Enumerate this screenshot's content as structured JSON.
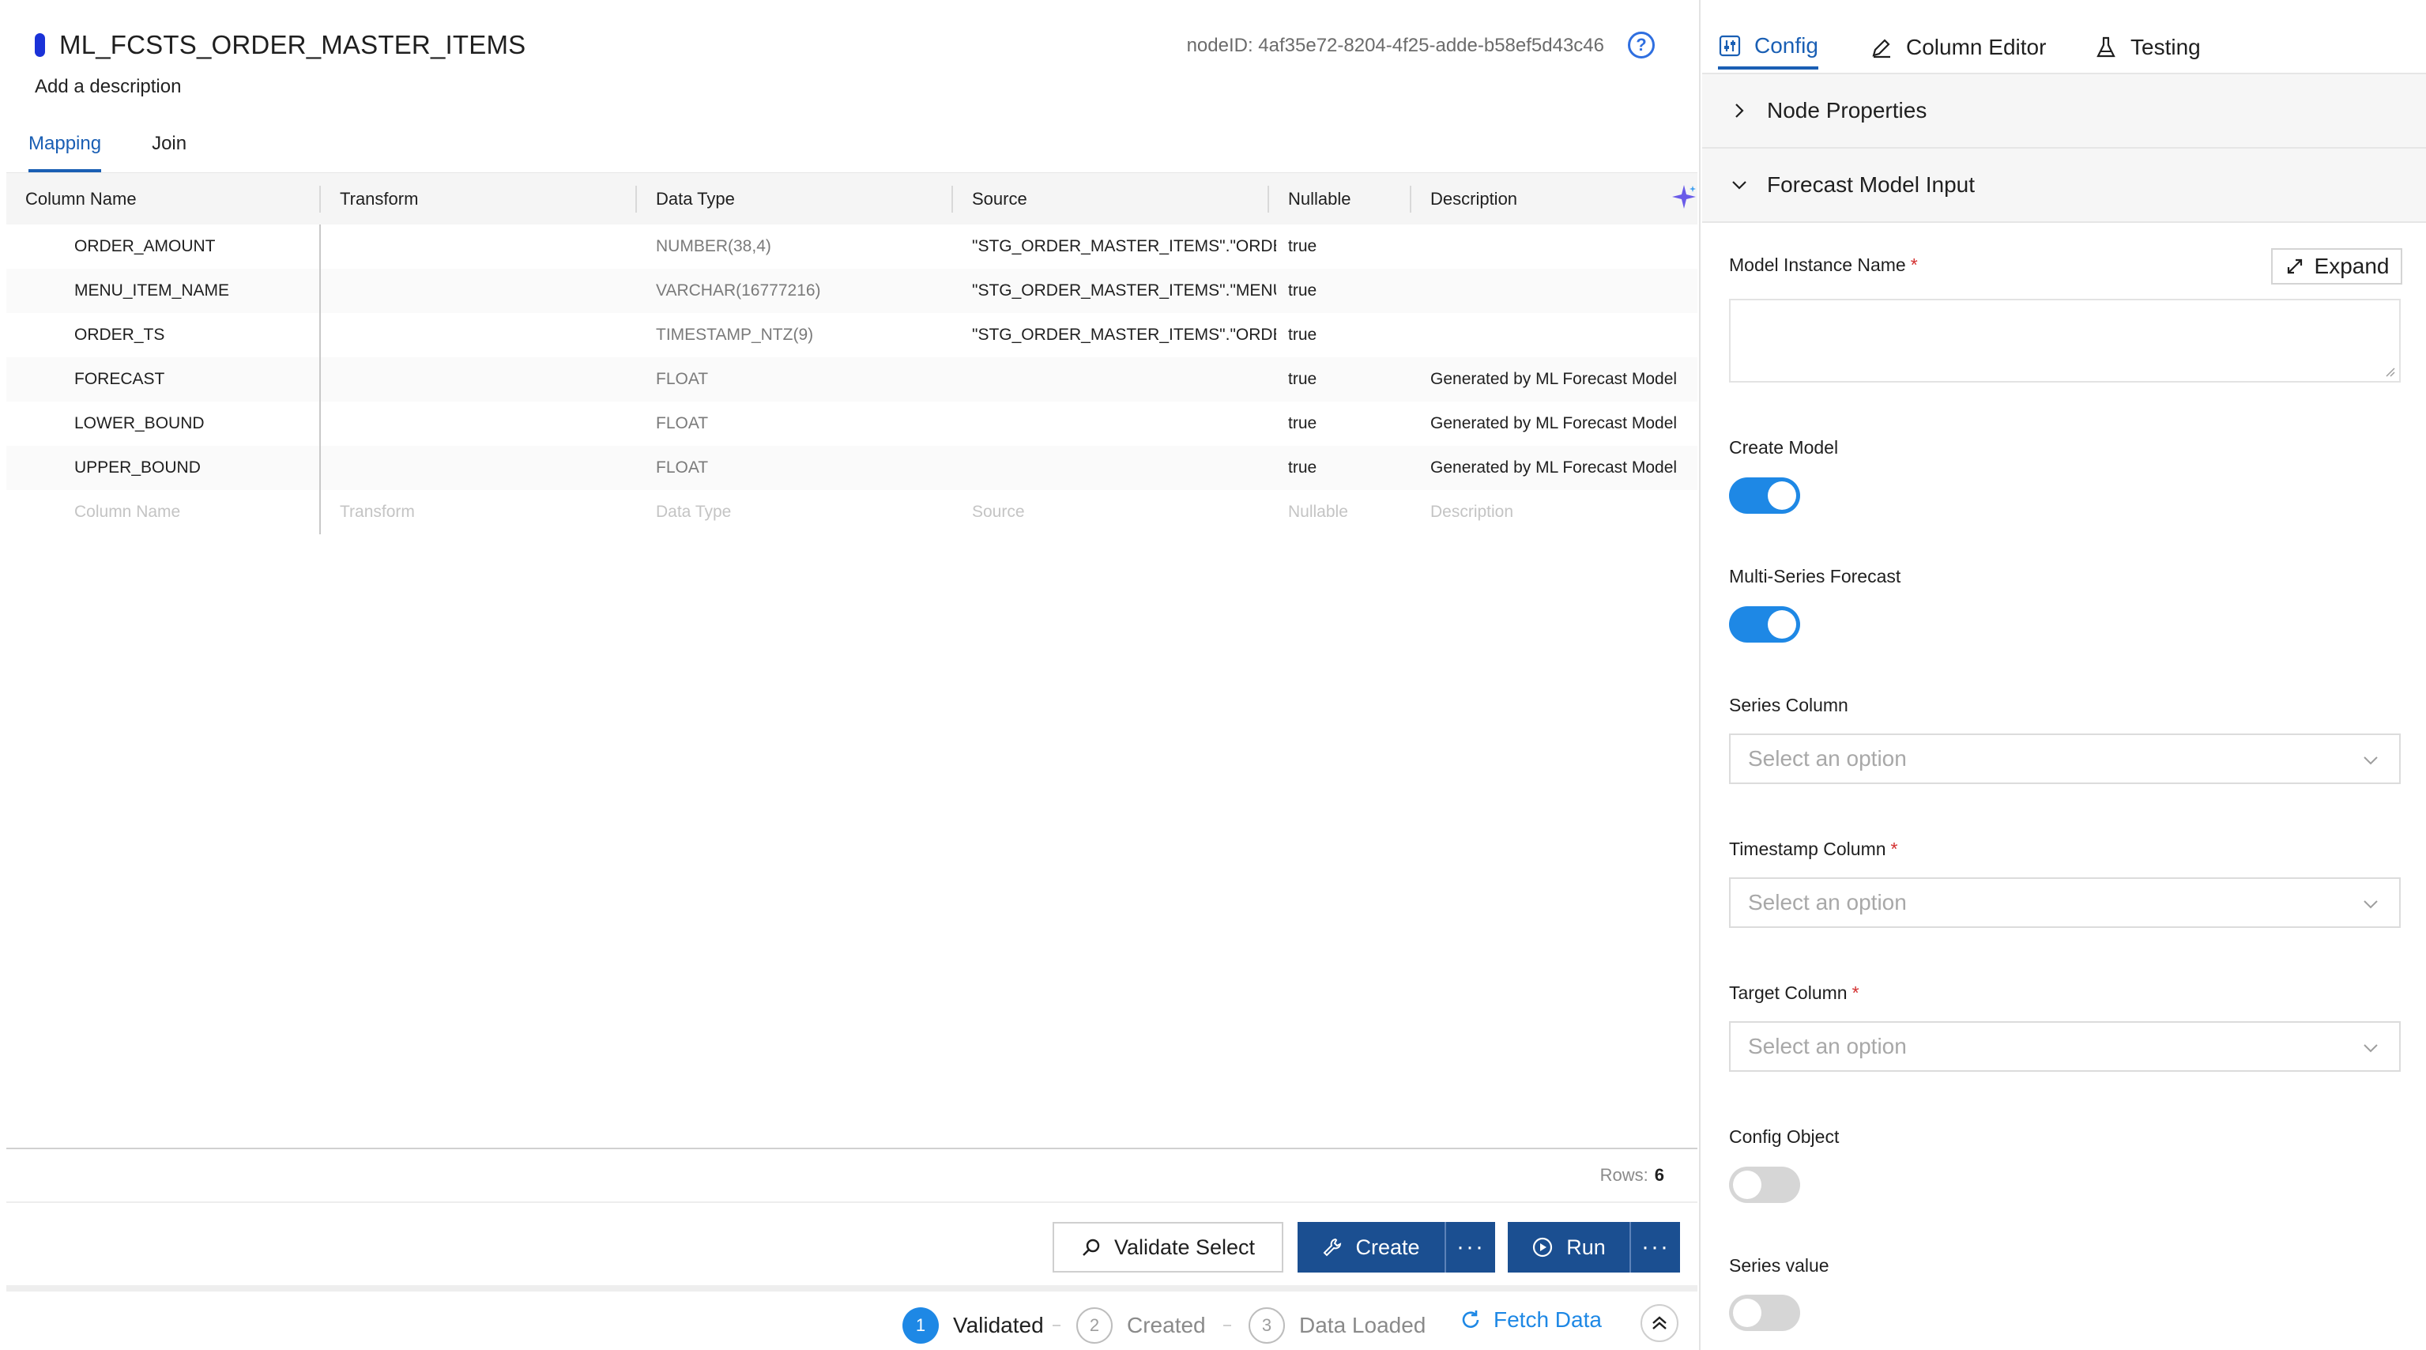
{
  "node": {
    "title": "ML_FCSTS_ORDER_MASTER_ITEMS",
    "description_placeholder": "Add a description",
    "node_id": "nodeID: 4af35e72-8204-4f25-adde-b58ef5d43c46"
  },
  "left_tabs": [
    {
      "label": "Mapping",
      "active": true
    },
    {
      "label": "Join",
      "active": false
    }
  ],
  "grid": {
    "headers": [
      "Column Name",
      "Transform",
      "Data Type",
      "Source",
      "Nullable",
      "Description"
    ],
    "rows": [
      {
        "name": "ORDER_AMOUNT",
        "transform": "",
        "data_type": "NUMBER(38,4)",
        "source": "\"STG_ORDER_MASTER_ITEMS\".\"ORDEI",
        "nullable": "true",
        "description": ""
      },
      {
        "name": "MENU_ITEM_NAME",
        "transform": "",
        "data_type": "VARCHAR(16777216)",
        "source": "\"STG_ORDER_MASTER_ITEMS\".\"MENU",
        "nullable": "true",
        "description": ""
      },
      {
        "name": "ORDER_TS",
        "transform": "",
        "data_type": "TIMESTAMP_NTZ(9)",
        "source": "\"STG_ORDER_MASTER_ITEMS\".\"ORDEI",
        "nullable": "true",
        "description": ""
      },
      {
        "name": "FORECAST",
        "transform": "",
        "data_type": "FLOAT",
        "source": "",
        "nullable": "true",
        "description": "Generated by ML Forecast Model"
      },
      {
        "name": "LOWER_BOUND",
        "transform": "",
        "data_type": "FLOAT",
        "source": "",
        "nullable": "true",
        "description": "Generated by ML Forecast Model"
      },
      {
        "name": "UPPER_BOUND",
        "transform": "",
        "data_type": "FLOAT",
        "source": "",
        "nullable": "true",
        "description": "Generated by ML Forecast Model"
      }
    ],
    "new_row_placeholders": {
      "name": "Column Name",
      "transform": "Transform",
      "data_type": "Data Type",
      "source": "Source",
      "nullable": "Nullable",
      "description": "Description"
    },
    "rows_label": "Rows:",
    "rows_count": "6"
  },
  "actions": {
    "validate_label": "Validate Select",
    "create_label": "Create",
    "run_label": "Run",
    "more_label": "···"
  },
  "status": {
    "steps": [
      {
        "num": "1",
        "label": "Validated",
        "state": "done"
      },
      {
        "num": "2",
        "label": "Created",
        "state": "todo"
      },
      {
        "num": "3",
        "label": "Data Loaded",
        "state": "todo"
      }
    ],
    "fetch_label": "Fetch Data"
  },
  "right_tabs": [
    {
      "label": "Config",
      "active": true
    },
    {
      "label": "Column Editor",
      "active": false
    },
    {
      "label": "Testing",
      "active": false
    }
  ],
  "sections": {
    "node_properties": "Node Properties",
    "forecast_model_input": "Forecast Model Input"
  },
  "form": {
    "model_instance_name_label": "Model Instance Name",
    "expand_label": "Expand",
    "create_model_label": "Create Model",
    "create_model_on": true,
    "multi_series_label": "Multi-Series Forecast",
    "multi_series_on": true,
    "series_column_label": "Series Column",
    "timestamp_column_label": "Timestamp Column",
    "target_column_label": "Target Column",
    "select_placeholder": "Select an option",
    "config_object_label": "Config Object",
    "config_object_on": false,
    "series_value_label": "Series value",
    "series_value_on": false,
    "required_mark": "*"
  },
  "colors": {
    "accent": "#1a5fb4",
    "primary_button": "#1b4f91",
    "toggle_on": "#1e88e5",
    "toggle_off": "#d6d6d6",
    "required": "#d32f2f"
  }
}
